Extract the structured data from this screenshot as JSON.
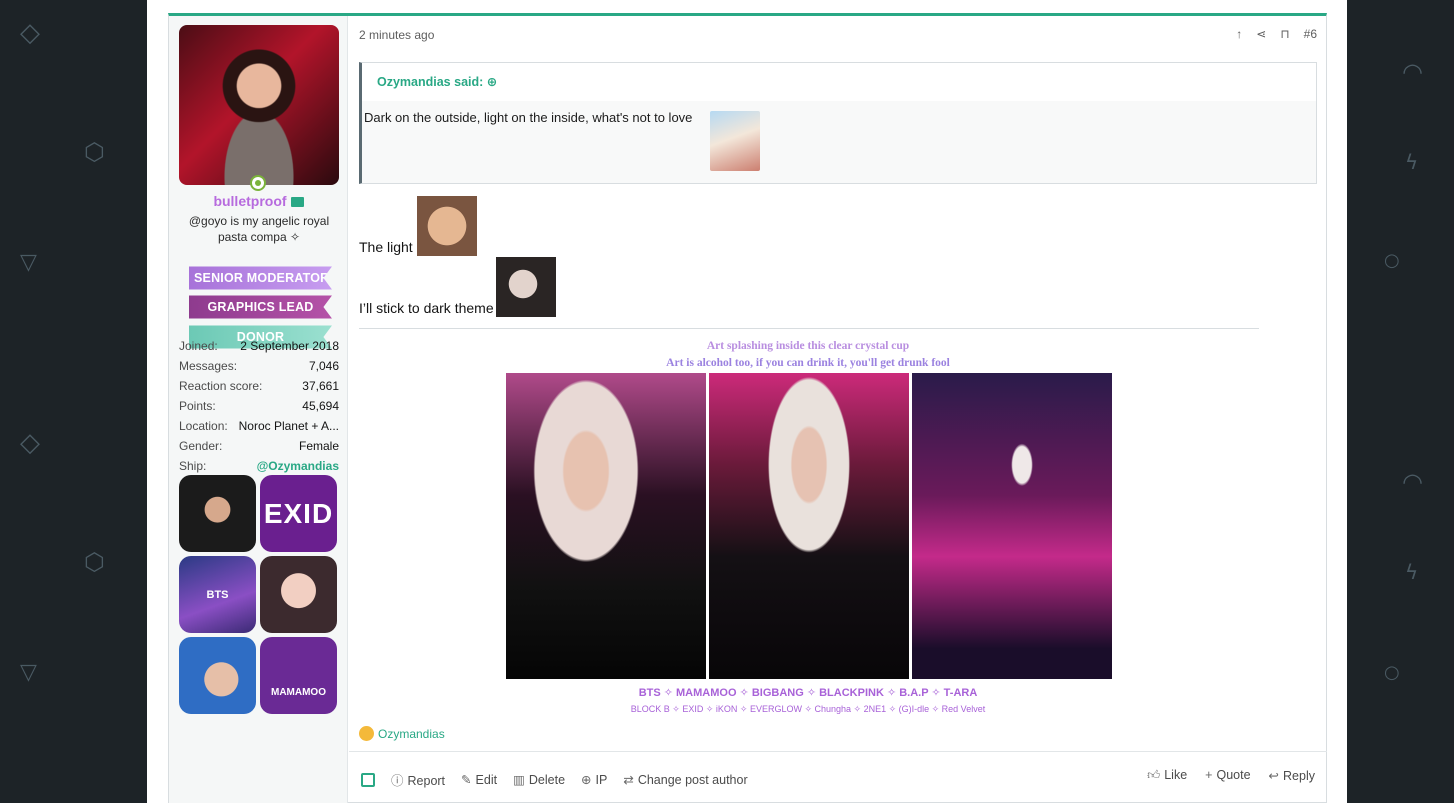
{
  "post": {
    "time": "2 minutes ago",
    "number": "#6"
  },
  "user": {
    "name": "bulletproof",
    "title": "@goyo is my angelic royal pasta compa ✧",
    "banners": [
      "SENIOR MODERATOR",
      "GRAPHICS LEAD",
      "DONOR"
    ],
    "stats": [
      {
        "label": "Joined:",
        "value": "2 September 2018"
      },
      {
        "label": "Messages:",
        "value": "7,046"
      },
      {
        "label": "Reaction score:",
        "value": "37,661"
      },
      {
        "label": "Points:",
        "value": "45,694"
      },
      {
        "label": "Location:",
        "value": "Noroc Planet + A..."
      },
      {
        "label": "Gender:",
        "value": "Female"
      },
      {
        "label": "Ship:",
        "value": "@Ozymandias"
      }
    ],
    "fandom_labels": [
      "EXID",
      "BTS",
      "MAMAMOO"
    ]
  },
  "quote": {
    "author": "Ozymandias said:",
    "text": "Dark on the outside, light on the inside, what's not to love"
  },
  "body": {
    "line1": "The light",
    "line2": "I’ll stick to dark theme"
  },
  "signature": {
    "lyric1": "Art splashing inside this clear crystal cup",
    "lyric2": "Art is alcohol too, if you can drink it, you'll get drunk fool",
    "groups_main": "BTS ✧ MAMAMOO ✧ BIGBANG ✧ BLACKPINK ✧ B.A.P ✧ T-ARA",
    "groups_more": "BLOCK B ✧ EXID ✧ iKON ✧ EVERGLOW ✧ Chungha ✧ 2NE1 ✧ (G)I-dle ✧ Red Velvet"
  },
  "reactions": {
    "users": "Ozymandias"
  },
  "footer": {
    "report": "Report",
    "edit": "Edit",
    "delete": "Delete",
    "ip": "IP",
    "change_author": "Change post author",
    "like": "Like",
    "quote": "Quote",
    "reply": "Reply"
  },
  "colors": {
    "accent": "#29a885",
    "username": "#b76bde",
    "signature": "#a862d8"
  }
}
